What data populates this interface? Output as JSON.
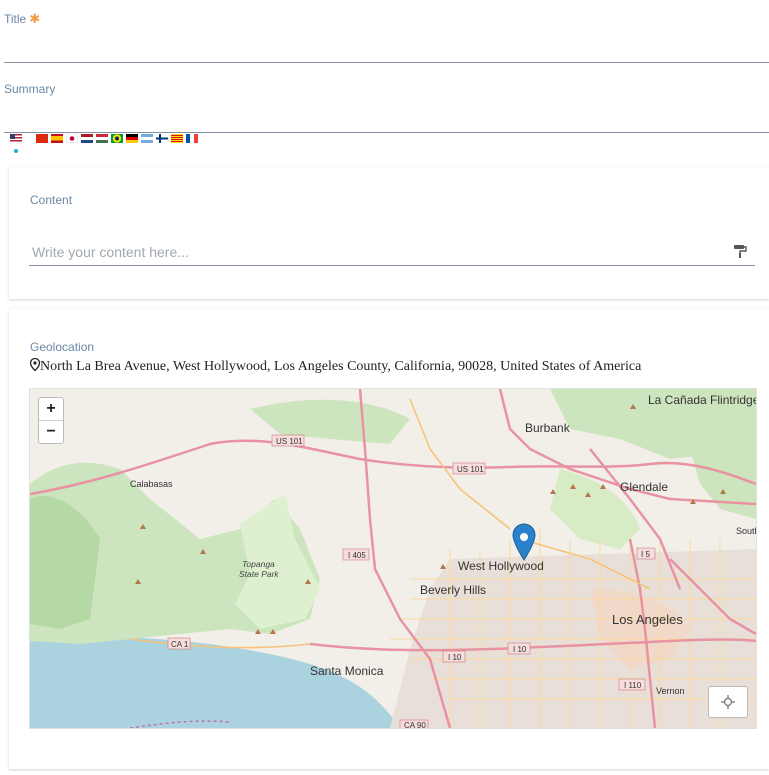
{
  "title": {
    "label": "Title",
    "required_mark": "✱",
    "value": ""
  },
  "summary": {
    "label": "Summary",
    "value": ""
  },
  "languages": [
    "us",
    "cn",
    "es",
    "jp",
    "nl",
    "hu",
    "br",
    "de",
    "ar",
    "fi",
    "ca",
    "fr"
  ],
  "content": {
    "label": "Content",
    "placeholder": "Write your content here..."
  },
  "geolocation": {
    "label": "Geolocation",
    "address": "North La Brea Avenue, West Hollywood, Los Angeles County, California, 90028, United States of America"
  },
  "map": {
    "zoom_in": "+",
    "zoom_out": "−",
    "places": [
      {
        "name": "Burbank",
        "big": true
      },
      {
        "name": "Glendale",
        "big": true
      },
      {
        "name": "La Cañada Flintridge",
        "big": true
      },
      {
        "name": "Calabasas",
        "big": false
      },
      {
        "name": "Topanga State Park",
        "big": false
      },
      {
        "name": "West Hollywood",
        "big": true
      },
      {
        "name": "Beverly Hills",
        "big": true
      },
      {
        "name": "Los Angeles",
        "big": true
      },
      {
        "name": "Santa Monica",
        "big": true
      },
      {
        "name": "Vernon",
        "big": false
      },
      {
        "name": "South",
        "big": false
      }
    ],
    "shields": [
      "US 101",
      "US 101",
      "I 405",
      "I 10",
      "I 10",
      "I 5",
      "CA 1",
      "I 110",
      "CA 90"
    ],
    "colors": {
      "land": "#f2efe9",
      "water": "#aad3df",
      "park": "#cde5bf",
      "road": "#f7c27b",
      "highway": "#e892a2",
      "marker": "#2a81cb"
    }
  }
}
